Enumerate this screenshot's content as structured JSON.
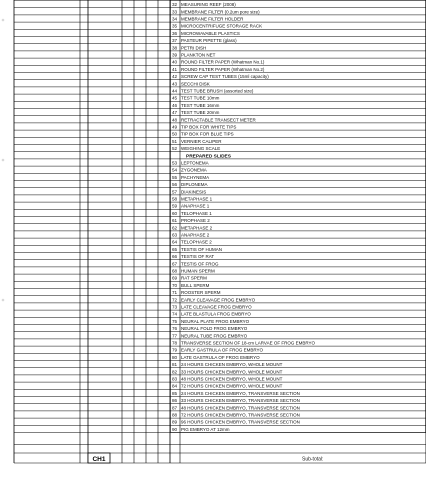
{
  "document": {
    "items": [
      {
        "no": "32",
        "desc": "MEASURING REEF (2008)"
      },
      {
        "no": "33",
        "desc": "MEMBRANE FILTER (0.2um pore size)"
      },
      {
        "no": "34",
        "desc": "MEMBRANE FILTER HOLDER"
      },
      {
        "no": "35",
        "desc": "MICROCENTRIFUGE STORAGE RACK"
      },
      {
        "no": "36",
        "desc": "MICROWAVABLE PLASTICS"
      },
      {
        "no": "37",
        "desc": "PASTEUR PIPETTE (glass)"
      },
      {
        "no": "38",
        "desc": "PETRI DISH"
      },
      {
        "no": "39",
        "desc": "PLANKTON NET"
      },
      {
        "no": "40",
        "desc": "ROUND FILTER PAPER (Whatman No.1)"
      },
      {
        "no": "41",
        "desc": "ROUND FILTER PAPER (Whatman No.2)"
      },
      {
        "no": "42",
        "desc": "SCREW CAP TEST TUBES (15ml capacity)"
      },
      {
        "no": "43",
        "desc": "SECCHI DISK"
      },
      {
        "no": "44",
        "desc": "TEST TUBE BRUSH (assorted size)"
      },
      {
        "no": "45",
        "desc": "TEST TUBE 10mm"
      },
      {
        "no": "46",
        "desc": "TEST TUBE 16mm"
      },
      {
        "no": "47",
        "desc": "TEST TUBE 20mm"
      },
      {
        "no": "48",
        "desc": "RETRACTABLE TRANSECT METER"
      },
      {
        "no": "49",
        "desc": "TIP BOX FOR WHITE TIPS"
      },
      {
        "no": "50",
        "desc": "TIP BOX FOR BLUE TIPS"
      },
      {
        "no": "51",
        "desc": "VERNIER CALIPER"
      },
      {
        "no": "52",
        "desc": "WEIGHING SCALE"
      },
      {
        "no": "",
        "desc": "PREPARED SLIDES",
        "heading": true
      },
      {
        "no": "53",
        "desc": "LEPTONEMA"
      },
      {
        "no": "54",
        "desc": "ZYGONEMA"
      },
      {
        "no": "55",
        "desc": "PACHYNEMA"
      },
      {
        "no": "56",
        "desc": "DIPLONEMA"
      },
      {
        "no": "57",
        "desc": "DIAKINESIS"
      },
      {
        "no": "58",
        "desc": "METAPHASE 1"
      },
      {
        "no": "59",
        "desc": "ANAPHASE 1"
      },
      {
        "no": "60",
        "desc": "TELOPHASE 1"
      },
      {
        "no": "61",
        "desc": "PROPHASE 2"
      },
      {
        "no": "62",
        "desc": "METAPHASE 2"
      },
      {
        "no": "63",
        "desc": "ANAPHASE 2"
      },
      {
        "no": "64",
        "desc": "TELOPHASE 2"
      },
      {
        "no": "65",
        "desc": "TESTIS OF HUMAN"
      },
      {
        "no": "66",
        "desc": "TESTIS OF RAT"
      },
      {
        "no": "67",
        "desc": "TESTIS OF FROG"
      },
      {
        "no": "68",
        "desc": "HUMAN SPERM"
      },
      {
        "no": "69",
        "desc": "RAT SPERM"
      },
      {
        "no": "70",
        "desc": "BULL SPERM"
      },
      {
        "no": "71",
        "desc": "ROOSTER SPERM"
      },
      {
        "no": "72",
        "desc": "EARLY CLEAVAGE FROG EMBRYO"
      },
      {
        "no": "73",
        "desc": "LATE CLEAVAGE FROG EMBRYO"
      },
      {
        "no": "74",
        "desc": "LATE BLASTULA FROG EMBRYO"
      },
      {
        "no": "75",
        "desc": "NEURAL PLATE FROG EMBRYO"
      },
      {
        "no": "76",
        "desc": "NEURAL FOLD FROG EMBRYO"
      },
      {
        "no": "77",
        "desc": "NEURAL TUBE FROG EMBRYO"
      },
      {
        "no": "78",
        "desc": "TRANSVERSE SECTION OF 18-cm LARVAE OF FROG EMBRYO"
      },
      {
        "no": "79",
        "desc": "EARLY GASTRULA OF FROG EMBRYO"
      },
      {
        "no": "80",
        "desc": "LATE GASTRULA OF FROG EMBRYO"
      },
      {
        "no": "81",
        "desc": "24 HOURS CHICKEN EMBRYO, WHOLE MOUNT"
      },
      {
        "no": "82",
        "desc": "33 HOURS CHICKEN EMBRYO, WHOLE MOUNT"
      },
      {
        "no": "83",
        "desc": "48 HOURS CHICKEN EMBRYO, WHOLE MOUNT"
      },
      {
        "no": "84",
        "desc": "72 HOURS CHICKEN EMBRYO, WHOLE MOUNT"
      },
      {
        "no": "85",
        "desc": "24 HOURS CHICKEN EMBRYO, TRANSVERSE SECTION"
      },
      {
        "no": "86",
        "desc": "33 HOURS CHICKEN EMBRYO, TRANSVERSE SECTION"
      },
      {
        "no": "87",
        "desc": "48 HOURS CHICKEN EMBRYO, TRANSVERSE SECTION"
      },
      {
        "no": "88",
        "desc": "72 HOURS CHICKEN EMBRYO, TRANSVERSE SECTION"
      },
      {
        "no": "89",
        "desc": "96 HOURS CHICKEN EMBRYO, TRANSVERSE SECTION"
      },
      {
        "no": "90",
        "desc": "PIG EMBRYO AT 12mm"
      }
    ],
    "footer": {
      "code": "CH1",
      "subtotal_label": "Sub-total:"
    }
  }
}
